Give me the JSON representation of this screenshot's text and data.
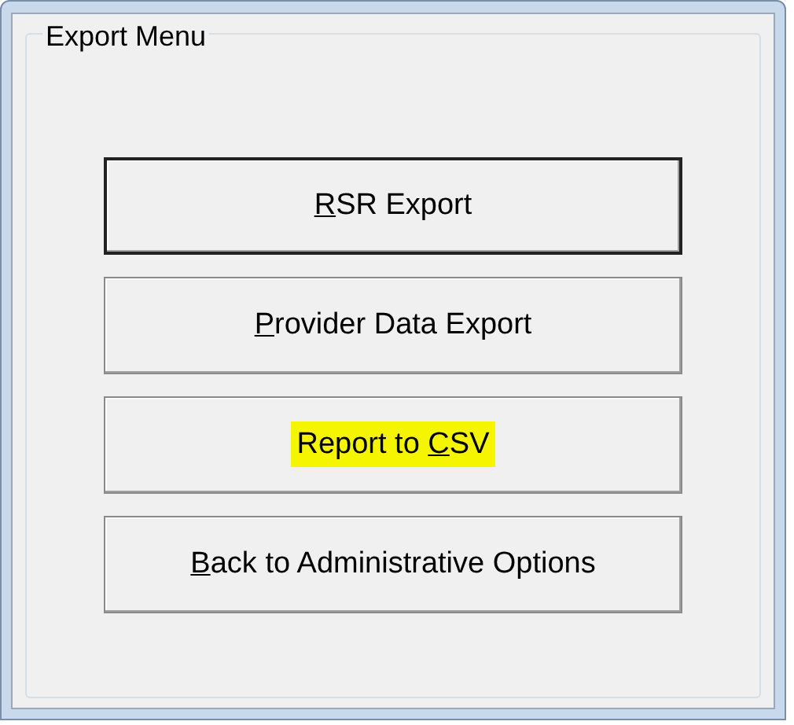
{
  "group": {
    "title": "Export Menu"
  },
  "buttons": [
    {
      "default": true,
      "highlighted": false,
      "label": [
        {
          "text": "R",
          "underline": true
        },
        {
          "text": "SR Export",
          "underline": false
        }
      ]
    },
    {
      "default": false,
      "highlighted": false,
      "label": [
        {
          "text": "P",
          "underline": true
        },
        {
          "text": "rovider Data Export",
          "underline": false
        }
      ]
    },
    {
      "default": false,
      "highlighted": true,
      "label": [
        {
          "text": "Report to ",
          "underline": false
        },
        {
          "text": "C",
          "underline": true
        },
        {
          "text": "SV",
          "underline": false
        }
      ]
    },
    {
      "default": false,
      "highlighted": false,
      "label": [
        {
          "text": "B",
          "underline": true
        },
        {
          "text": "ack to Administrative Options",
          "underline": false
        }
      ]
    }
  ]
}
